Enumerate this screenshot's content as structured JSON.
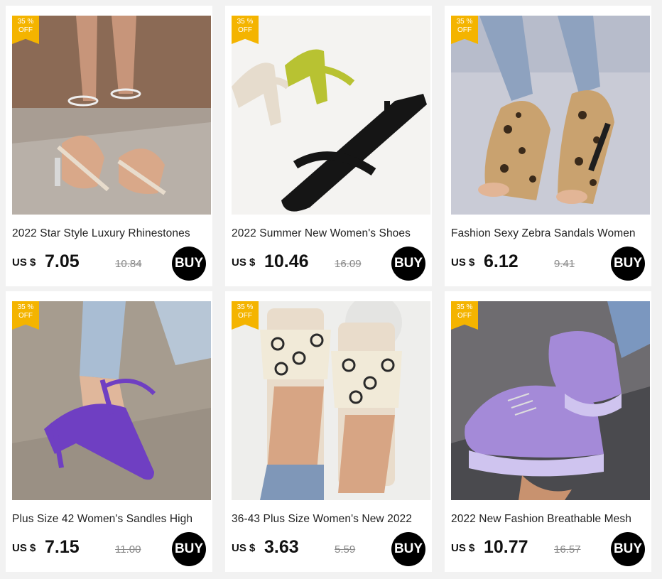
{
  "products": [
    {
      "discount_pct": "35 %",
      "discount_off": "OFF",
      "title": "2022 Star Style Luxury Rhinestones",
      "currency": "US $",
      "price": "7.05",
      "old_price": "10.84",
      "buy_label": "BUY"
    },
    {
      "discount_pct": "35 %",
      "discount_off": "OFF",
      "title": "2022 Summer New Women's Shoes",
      "currency": "US $",
      "price": "10.46",
      "old_price": "16.09",
      "buy_label": "BUY"
    },
    {
      "discount_pct": "35 %",
      "discount_off": "OFF",
      "title": "Fashion Sexy Zebra Sandals Women",
      "currency": "US $",
      "price": "6.12",
      "old_price": "9.41",
      "buy_label": "BUY"
    },
    {
      "discount_pct": "35 %",
      "discount_off": "OFF",
      "title": "Plus Size 42 Women's Sandles High",
      "currency": "US $",
      "price": "7.15",
      "old_price": "11.00",
      "buy_label": "BUY"
    },
    {
      "discount_pct": "35 %",
      "discount_off": "OFF",
      "title": "36-43 Plus Size Women's New 2022",
      "currency": "US $",
      "price": "3.63",
      "old_price": "5.59",
      "buy_label": "BUY"
    },
    {
      "discount_pct": "35 %",
      "discount_off": "OFF",
      "title": "2022 New Fashion Breathable Mesh",
      "currency": "US $",
      "price": "10.77",
      "old_price": "16.57",
      "buy_label": "BUY"
    }
  ],
  "colors": {
    "badge": "#f4b400",
    "buy": "#000000",
    "card": "#ffffff",
    "page": "#f2f2f2"
  }
}
